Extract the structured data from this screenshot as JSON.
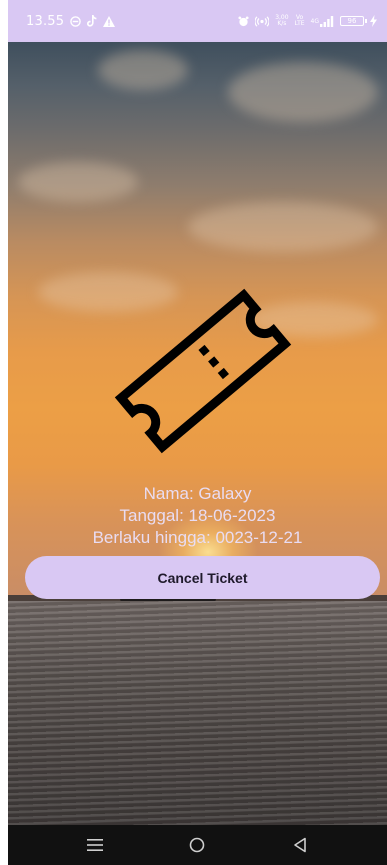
{
  "status_bar": {
    "time": "13.55",
    "net_speed_value": "3,00",
    "net_speed_unit": "K/s",
    "vo_label": "Vo\nLTE",
    "signal_label": "4G",
    "battery_level": "96"
  },
  "ticket": {
    "name_line": "Nama: Galaxy",
    "date_line": "Tanggal: 18-06-2023",
    "valid_line": "Berlaku hingga: 0023-12-21"
  },
  "actions": {
    "cancel_label": "Cancel Ticket"
  },
  "nav": {
    "items": [
      "menu-icon",
      "home-icon",
      "back-icon"
    ]
  },
  "colors": {
    "accent": "#d9c8f3",
    "info_text": "#e9dcf2",
    "nav_background": "#111111"
  }
}
